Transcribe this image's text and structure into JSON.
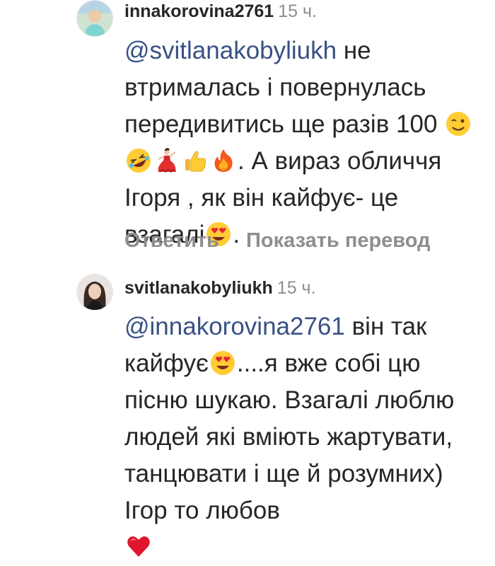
{
  "comments": [
    {
      "username": "innakorovina2761",
      "time": "15 ч.",
      "mention": "@svitlanakobyliukh",
      "text_1": " не втрималась і повернулась передивитись ще разів 100 ",
      "text_2": ". А вираз обличчя Ігоря , як він кайфує- це взагалі",
      "text_3": ".",
      "emojis_1": [
        "winking-face",
        "rolling-on-floor-laughing",
        "flamenco-dancer",
        "thumbs-up",
        "fire"
      ],
      "emojis_2": [
        "heart-eyes"
      ],
      "reply_label": "Ответить",
      "translate_label": "Показать перевод"
    },
    {
      "username": "svitlanakobyliukh",
      "time": "15 ч.",
      "mention": "@innakorovina2761",
      "text_1": " він так кайфує",
      "text_2": "....я вже собі цю пісню шукаю. Взагалі люблю людей які вміють жартувати, танцювати і ще й розумних) Ігор то любов",
      "emojis_1": [
        "heart-eyes"
      ],
      "emojis_2": [
        "red-heart"
      ]
    }
  ],
  "colors": {
    "mention": "#385185",
    "text": "#262626",
    "muted": "#8e8e8e"
  }
}
